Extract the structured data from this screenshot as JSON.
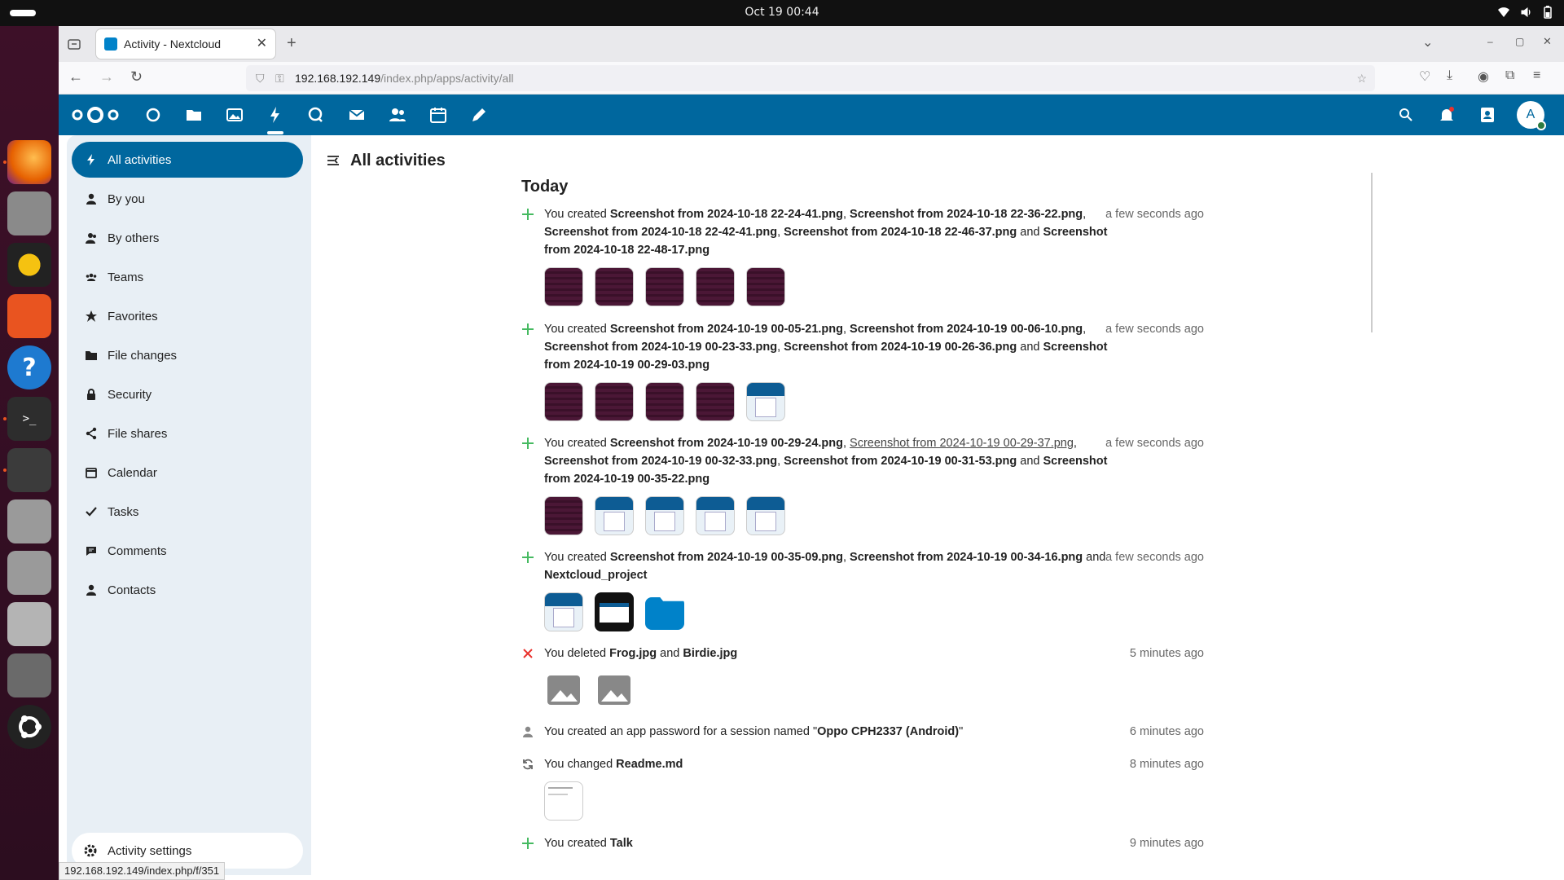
{
  "system": {
    "clock": "Oct 19  00:44"
  },
  "dock": {
    "apps": [
      "firefox-icon",
      "files-icon",
      "rhythmbox-icon",
      "app-center-icon",
      "help-icon",
      "terminal-icon",
      "software-updater-icon",
      "drive-icon",
      "drive-icon",
      "text-editor-icon",
      "trash-icon",
      "ubuntu-icon"
    ]
  },
  "browser": {
    "tab_title": "Activity - Nextcloud",
    "url_host": "192.168.192.149",
    "url_path": "/index.php/apps/activity/all",
    "status_url": "192.168.192.149/index.php/f/351"
  },
  "sidebar": {
    "items": [
      {
        "label": "All activities",
        "icon": "lightning-icon"
      },
      {
        "label": "By you",
        "icon": "person-icon"
      },
      {
        "label": "By others",
        "icon": "people-icon"
      },
      {
        "label": "Teams",
        "icon": "group-icon"
      },
      {
        "label": "Favorites",
        "icon": "star-icon"
      },
      {
        "label": "File changes",
        "icon": "folder-icon"
      },
      {
        "label": "Security",
        "icon": "lock-icon"
      },
      {
        "label": "File shares",
        "icon": "share-icon"
      },
      {
        "label": "Calendar",
        "icon": "calendar-icon"
      },
      {
        "label": "Tasks",
        "icon": "check-icon"
      },
      {
        "label": "Comments",
        "icon": "comment-icon"
      },
      {
        "label": "Contacts",
        "icon": "contact-icon"
      }
    ],
    "settings_label": "Activity settings"
  },
  "main": {
    "title": "All activities",
    "section": "Today"
  },
  "activities": [
    {
      "icon": "plus-icon",
      "time": "a few seconds ago",
      "parts": [
        [
          "You created ",
          0
        ],
        [
          "Screenshot from 2024-10-18 22-24-41.png",
          1
        ],
        [
          ", ",
          0
        ],
        [
          "Screenshot from 2024-10-18 22-36-22.png",
          1
        ],
        [
          ", ",
          0
        ],
        [
          "Screenshot from 2024-10-18 22-42-41.png",
          1
        ],
        [
          ", ",
          0
        ],
        [
          "Screenshot from 2024-10-18 22-46-37.png",
          1
        ],
        [
          " and ",
          0
        ],
        [
          "Screenshot from 2024-10-18 22-48-17.png",
          1
        ]
      ],
      "thumbs": [
        "dark",
        "dark",
        "dark",
        "dark",
        "dark"
      ]
    },
    {
      "icon": "plus-icon",
      "time": "a few seconds ago",
      "parts": [
        [
          "You created ",
          0
        ],
        [
          "Screenshot from 2024-10-19 00-05-21.png",
          1
        ],
        [
          ", ",
          0
        ],
        [
          "Screenshot from 2024-10-19 00-06-10.png",
          1
        ],
        [
          ", ",
          0
        ],
        [
          "Screenshot from 2024-10-19 00-23-33.png",
          1
        ],
        [
          ", ",
          0
        ],
        [
          "Screenshot from 2024-10-19 00-26-36.png",
          1
        ],
        [
          " and ",
          0
        ],
        [
          "Screenshot from 2024-10-19 00-29-03.png",
          1
        ]
      ],
      "thumbs": [
        "dark",
        "dark",
        "dark",
        "dark",
        "nc"
      ]
    },
    {
      "icon": "plus-icon",
      "time": "a few seconds ago",
      "parts": [
        [
          "You created ",
          0
        ],
        [
          "Screenshot from 2024-10-19 00-29-24.png",
          1
        ],
        [
          ", ",
          0
        ],
        [
          "Screenshot from 2024-10-19 00-29-37.png",
          2
        ],
        [
          ", ",
          0
        ],
        [
          "Screenshot from 2024-10-19 00-32-33.png",
          1
        ],
        [
          ", ",
          0
        ],
        [
          "Screenshot from 2024-10-19 00-31-53.png",
          1
        ],
        [
          " and ",
          0
        ],
        [
          "Screenshot from 2024-10-19 00-35-22.png",
          1
        ]
      ],
      "thumbs": [
        "dark",
        "nc",
        "nc",
        "nc",
        "nc"
      ]
    },
    {
      "icon": "plus-icon",
      "time": "a few seconds ago",
      "parts": [
        [
          "You created ",
          0
        ],
        [
          "Screenshot from 2024-10-19 00-35-09.png",
          1
        ],
        [
          ", ",
          0
        ],
        [
          "Screenshot from 2024-10-19 00-34-16.png",
          1
        ],
        [
          " and ",
          0
        ],
        [
          "Nextcloud_project",
          1
        ]
      ],
      "thumbs": [
        "nc",
        "black",
        "folder"
      ]
    },
    {
      "icon": "cross-icon",
      "time": "5 minutes ago",
      "parts": [
        [
          "You deleted ",
          0
        ],
        [
          "Frog.jpg",
          1
        ],
        [
          " and ",
          0
        ],
        [
          "Birdie.jpg",
          1
        ]
      ],
      "thumbs": [
        "img",
        "img"
      ]
    },
    {
      "icon": "person-icon",
      "time": "6 minutes ago",
      "parts": [
        [
          "You created an app password for a session named \"",
          0
        ],
        [
          "Oppo CPH2337 (Android)",
          1
        ],
        [
          "\"",
          0
        ]
      ],
      "thumbs": []
    },
    {
      "icon": "sync-icon",
      "time": "8 minutes ago",
      "parts": [
        [
          "You changed ",
          0
        ],
        [
          "Readme.md",
          1
        ]
      ],
      "thumbs": [
        "doc"
      ]
    },
    {
      "icon": "plus-icon",
      "time": "9 minutes ago",
      "parts": [
        [
          "You created ",
          0
        ],
        [
          "Talk",
          1
        ]
      ],
      "thumbs": []
    }
  ]
}
